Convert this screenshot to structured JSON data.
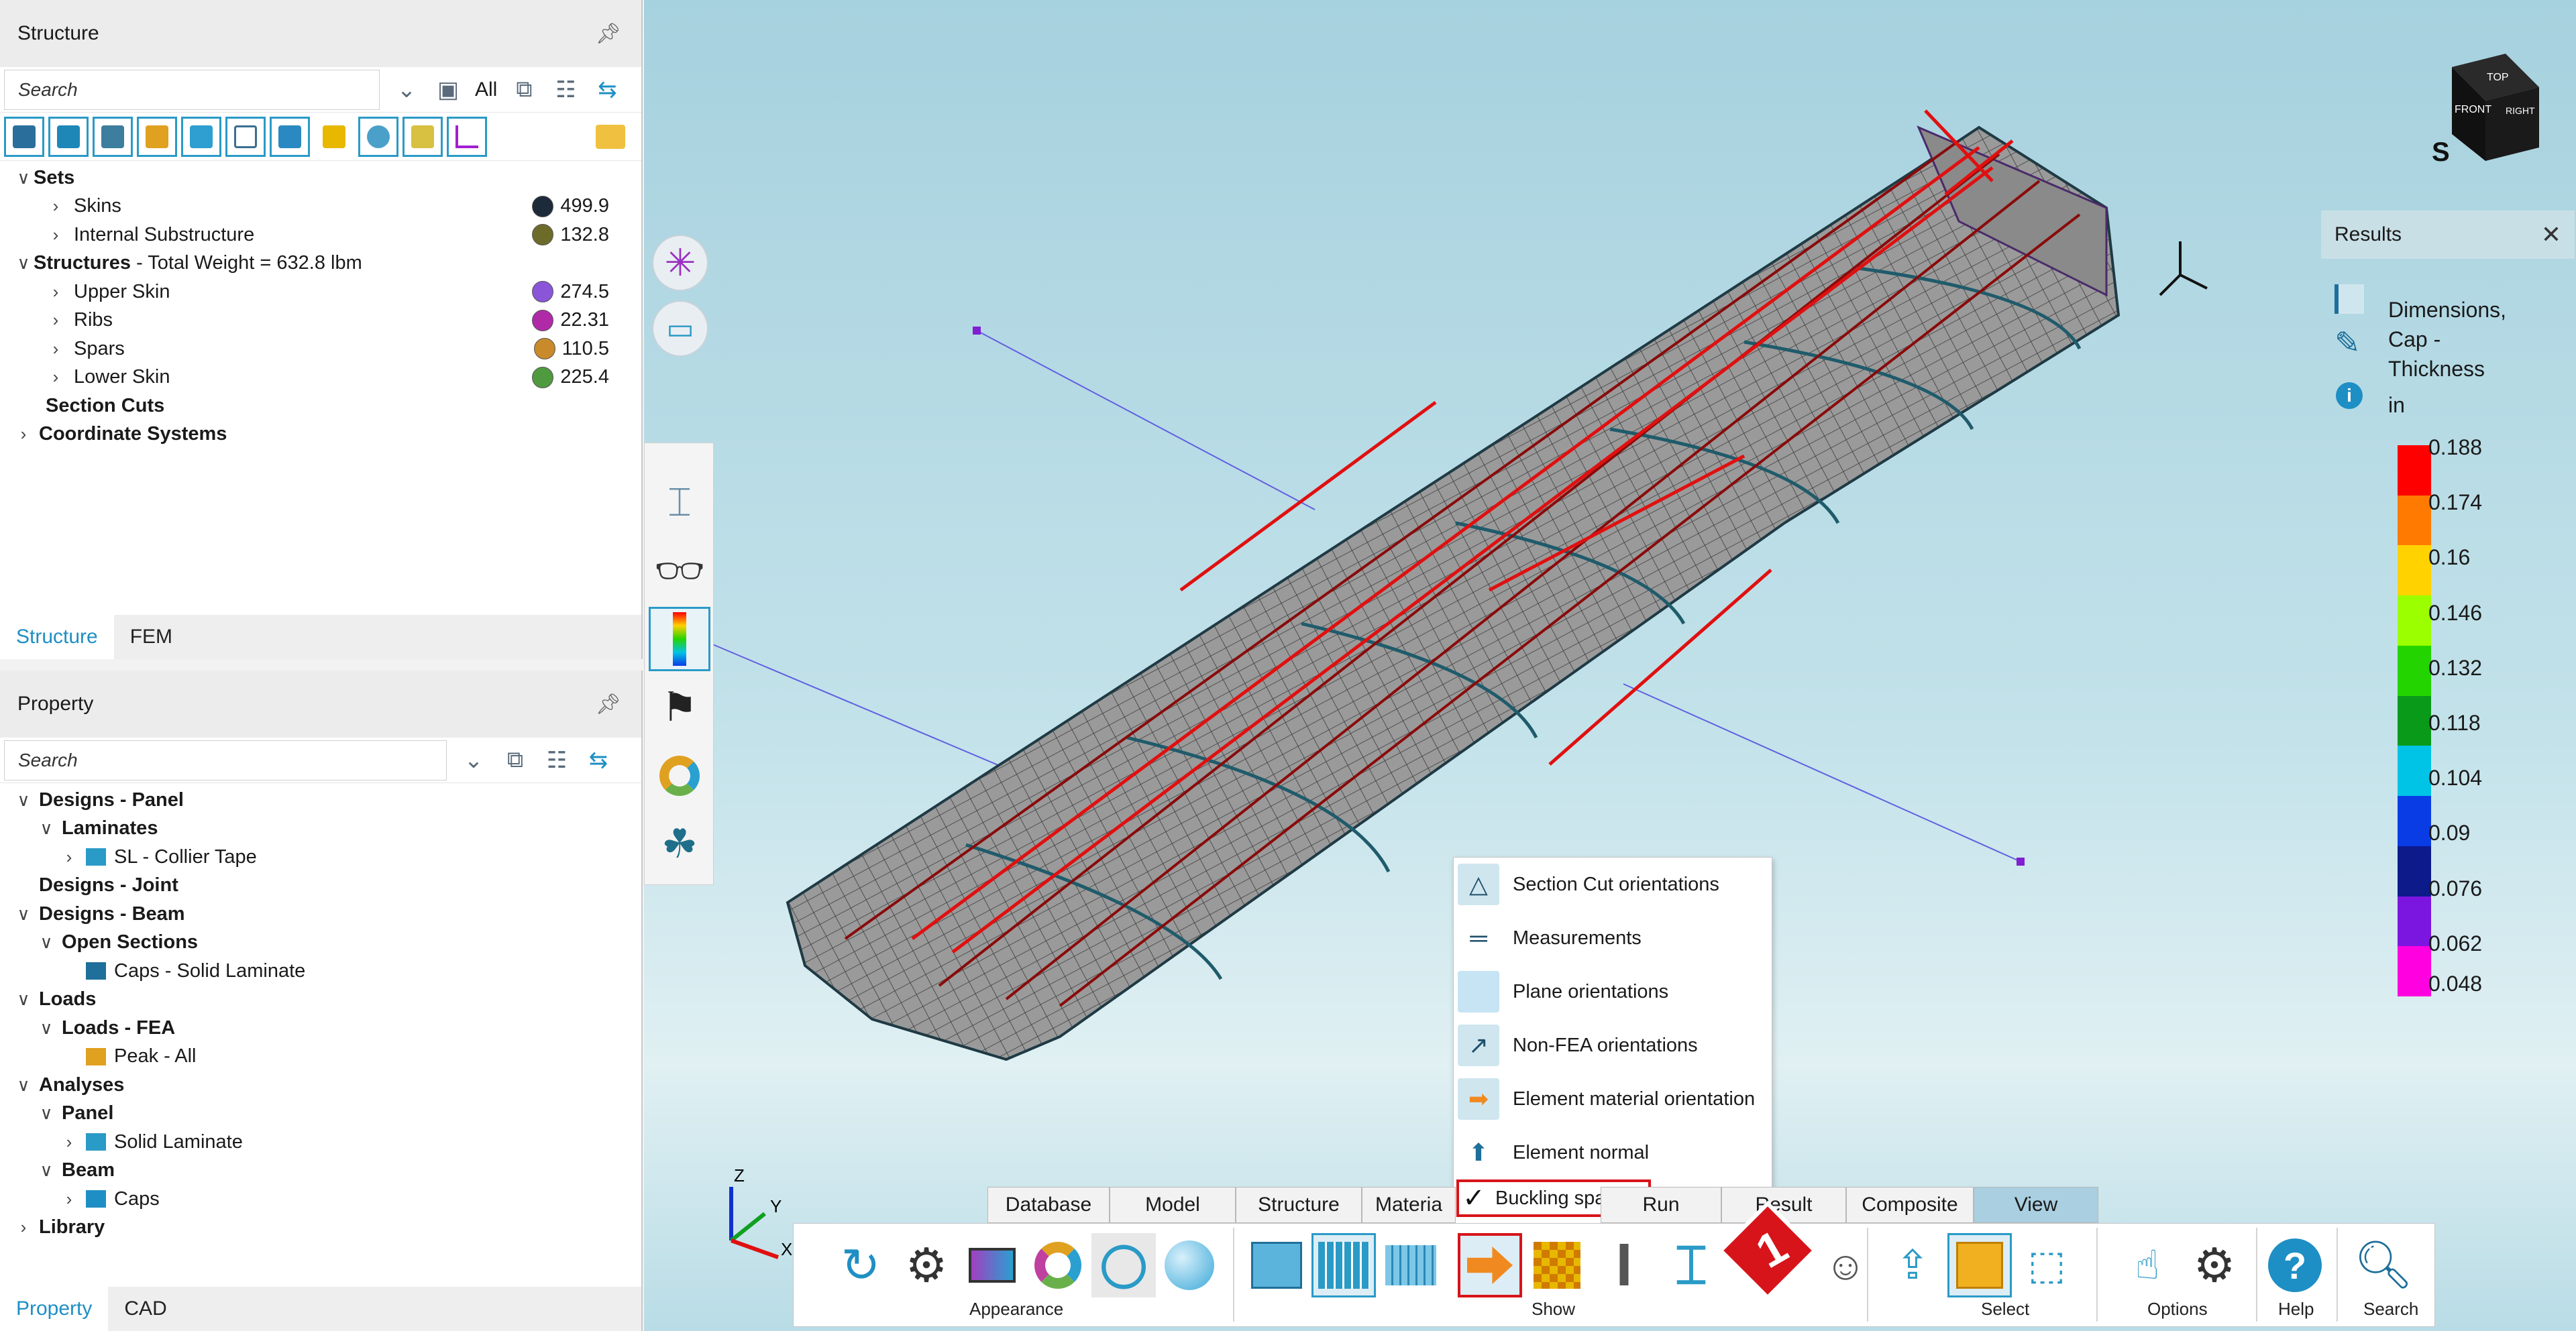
{
  "structure_panel": {
    "title": "Structure",
    "search_placeholder": "Search",
    "filter_label": "All",
    "tree": {
      "sets_label": "Sets",
      "sets": [
        {
          "label": "Skins",
          "weight": "499.9",
          "color": "#1d2a3a"
        },
        {
          "label": "Internal Substructure",
          "weight": "132.8",
          "color": "#6d6b2a"
        }
      ],
      "structures_label": "Structures",
      "structures_suffix": " - Total Weight = 632.8 lbm",
      "structures": [
        {
          "label": "Upper Skin",
          "weight": "274.5",
          "color": "#8a55d8"
        },
        {
          "label": "Ribs",
          "weight": "22.31",
          "color": "#b02aa8"
        },
        {
          "label": "Spars",
          "weight": "110.5",
          "color": "#c88a2a"
        },
        {
          "label": "Lower Skin",
          "weight": "225.4",
          "color": "#4f9a3e"
        }
      ],
      "section_cuts_label": "Section Cuts",
      "coord_systems_label": "Coordinate Systems"
    },
    "tabs": [
      "Structure",
      "FEM"
    ]
  },
  "property_panel": {
    "title": "Property",
    "search_placeholder": "Search",
    "tree": [
      {
        "label": "Designs - Panel",
        "level": 0,
        "bold": true,
        "chev": "down"
      },
      {
        "label": "Laminates",
        "level": 1,
        "bold": true,
        "chev": "down"
      },
      {
        "label": "SL - Collier Tape",
        "level": 2,
        "bold": false,
        "chev": "right",
        "icon": "laminate-icon"
      },
      {
        "label": "Designs - Joint",
        "level": 0,
        "bold": true,
        "chev": ""
      },
      {
        "label": "Designs - Beam",
        "level": 0,
        "bold": true,
        "chev": "down"
      },
      {
        "label": "Open Sections",
        "level": 1,
        "bold": true,
        "chev": "down"
      },
      {
        "label": "Caps - Solid Laminate",
        "level": 2,
        "bold": false,
        "chev": "",
        "icon": "beam-section-icon"
      },
      {
        "label": "Loads",
        "level": 0,
        "bold": true,
        "chev": "down"
      },
      {
        "label": "Loads - FEA",
        "level": 1,
        "bold": true,
        "chev": "down"
      },
      {
        "label": "Peak - All",
        "level": 2,
        "bold": false,
        "chev": "",
        "icon": "load-case-icon"
      },
      {
        "label": "Analyses",
        "level": 0,
        "bold": true,
        "chev": "down"
      },
      {
        "label": "Panel",
        "level": 1,
        "bold": true,
        "chev": "down"
      },
      {
        "label": "Solid Laminate",
        "level": 2,
        "bold": false,
        "chev": "right",
        "icon": "laminate-icon"
      },
      {
        "label": "Beam",
        "level": 1,
        "bold": true,
        "chev": "down"
      },
      {
        "label": "Caps",
        "level": 2,
        "bold": false,
        "chev": "right",
        "icon": "i-beam-icon"
      },
      {
        "label": "Library",
        "level": 0,
        "bold": true,
        "chev": "right"
      }
    ],
    "tabs": [
      "Property",
      "CAD"
    ]
  },
  "results_panel": {
    "title": "Results",
    "lines": [
      "Dimensions,",
      "Cap -",
      "Thickness"
    ],
    "unit": "in",
    "scale_values": [
      "0.188",
      "0.174",
      "0.16",
      "0.146",
      "0.132",
      "0.118",
      "0.104",
      "0.09",
      "0.076",
      "0.062",
      "0.048"
    ],
    "scale_colors": [
      "#ff0000",
      "#ff7a00",
      "#ffd200",
      "#9cff00",
      "#24d400",
      "#0a9a1a",
      "#00c4e6",
      "#0a3ce6",
      "#0c1a8a",
      "#7a16e0",
      "#ff00e0"
    ]
  },
  "context_menu": {
    "items": [
      {
        "label": "Section Cut orientations",
        "icon": "section-cut-icon",
        "checked": false
      },
      {
        "label": "Measurements",
        "icon": "ruler-icon",
        "checked": false
      },
      {
        "label": "Plane orientations",
        "icon": "plane-icon",
        "checked": false
      },
      {
        "label": "Non-FEA orientations",
        "icon": "non-fea-icon",
        "checked": false
      },
      {
        "label": "Element material orientation",
        "icon": "orientation-arrow-icon",
        "checked": false
      },
      {
        "label": "Element normal",
        "icon": "normal-arrow-icon",
        "checked": false
      },
      {
        "label": "Buckling spans",
        "icon": "check-icon",
        "checked": true
      }
    ]
  },
  "ribbon": {
    "tabs": [
      "Database",
      "Model",
      "Structure",
      "Materia",
      "Run",
      "Result",
      "Composite",
      "View"
    ],
    "active_tab": "View",
    "groups": [
      "Appearance",
      "Show",
      "Select",
      "Options",
      "Help",
      "Search"
    ]
  },
  "axis_labels": {
    "z": "Z",
    "y": "Y",
    "x": "X"
  },
  "step_badge": "1",
  "nav_cube": {
    "top": "TOP",
    "front": "FRONT",
    "right": "RIGHT",
    "compass": "S"
  },
  "colors": {
    "accent": "#1e8fc4",
    "highlight": "#d7141a",
    "mesh_edge": "#1f5b6b",
    "spar_line": "#8a0a0a"
  }
}
